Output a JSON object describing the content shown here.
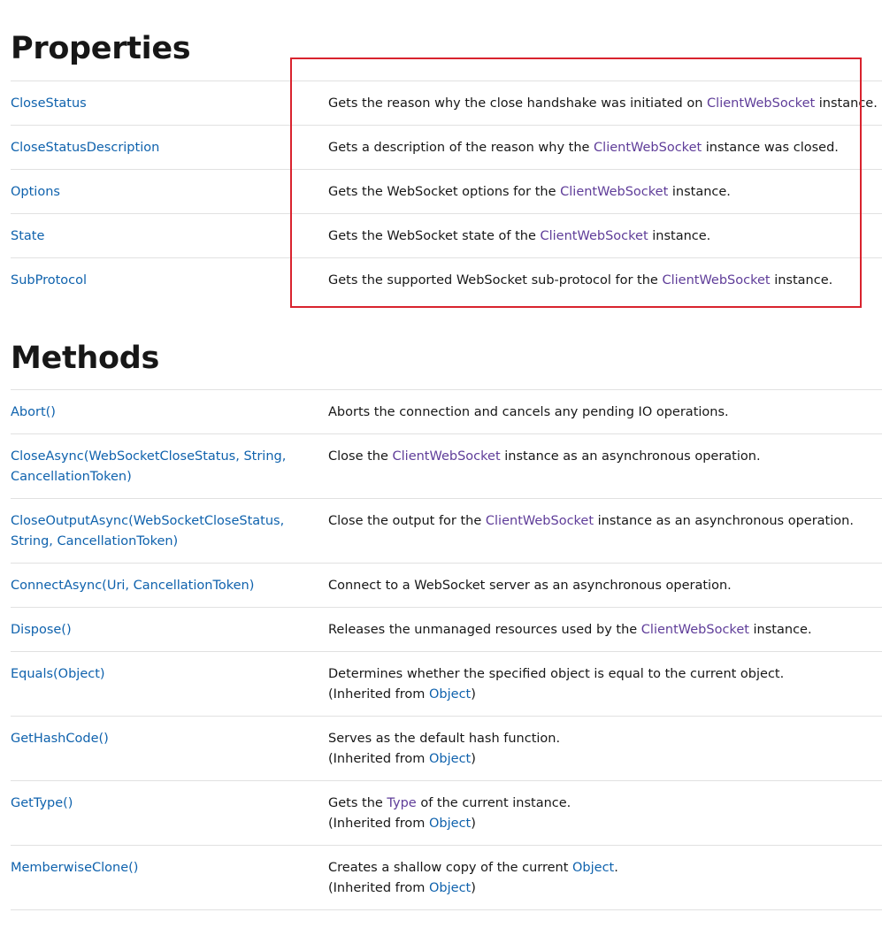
{
  "properties": {
    "title": "Properties",
    "rows": [
      {
        "name": "CloseStatus",
        "desc": [
          "Gets the reason why the close handshake was initiated on ",
          "ClientWebSocket",
          " instance."
        ]
      },
      {
        "name": "CloseStatusDescription",
        "desc": [
          "Gets a description of the reason why the ",
          "ClientWebSocket",
          " instance was closed."
        ]
      },
      {
        "name": "Options",
        "desc": [
          "Gets the WebSocket options for the ",
          "ClientWebSocket",
          " instance."
        ]
      },
      {
        "name": "State",
        "desc": [
          "Gets the WebSocket state of the ",
          "ClientWebSocket",
          " instance."
        ]
      },
      {
        "name": "SubProtocol",
        "desc": [
          "Gets the supported WebSocket sub-protocol for the ",
          "ClientWebSocket",
          " instance."
        ]
      }
    ]
  },
  "methods": {
    "title": "Methods",
    "inherited_prefix": "(Inherited from ",
    "inherited_suffix": ")",
    "rows": [
      {
        "name_lines": [
          "Abort()"
        ],
        "desc": [
          "Aborts the connection and cancels any pending IO operations."
        ]
      },
      {
        "name_lines": [
          "CloseAsync(WebSocketCloseStatus, String,",
          "CancellationToken)"
        ],
        "desc": [
          "Close the ",
          "ClientWebSocket",
          " instance as an asynchronous operation."
        ]
      },
      {
        "name_lines": [
          "CloseOutputAsync(WebSocketCloseStatus,",
          "String, CancellationToken)"
        ],
        "desc": [
          "Close the output for the ",
          "ClientWebSocket",
          " instance as an asynchronous operation."
        ]
      },
      {
        "name_lines": [
          "ConnectAsync(Uri, CancellationToken)"
        ],
        "desc": [
          "Connect to a WebSocket server as an asynchronous operation."
        ]
      },
      {
        "name_lines": [
          "Dispose()"
        ],
        "desc": [
          "Releases the unmanaged resources used by the ",
          "ClientWebSocket",
          " instance."
        ]
      },
      {
        "name_lines": [
          "Equals(Object)"
        ],
        "desc": [
          "Determines whether the specified object is equal to the current object."
        ],
        "inherited": "Object"
      },
      {
        "name_lines": [
          "GetHashCode()"
        ],
        "desc": [
          "Serves as the default hash function."
        ],
        "inherited": "Object"
      },
      {
        "name_lines": [
          "GetType()"
        ],
        "desc": [
          "Gets the ",
          "Type",
          " of the current instance."
        ],
        "inherited": "Object"
      },
      {
        "name_lines": [
          "MemberwiseClone()"
        ],
        "desc": [
          "Creates a shallow copy of the current ",
          "Object",
          "."
        ],
        "inherited": "Object"
      }
    ]
  },
  "colors": {
    "member_link": "#0f62ad",
    "type_link": "#5f3d99",
    "highlight_border": "#d9232e"
  }
}
